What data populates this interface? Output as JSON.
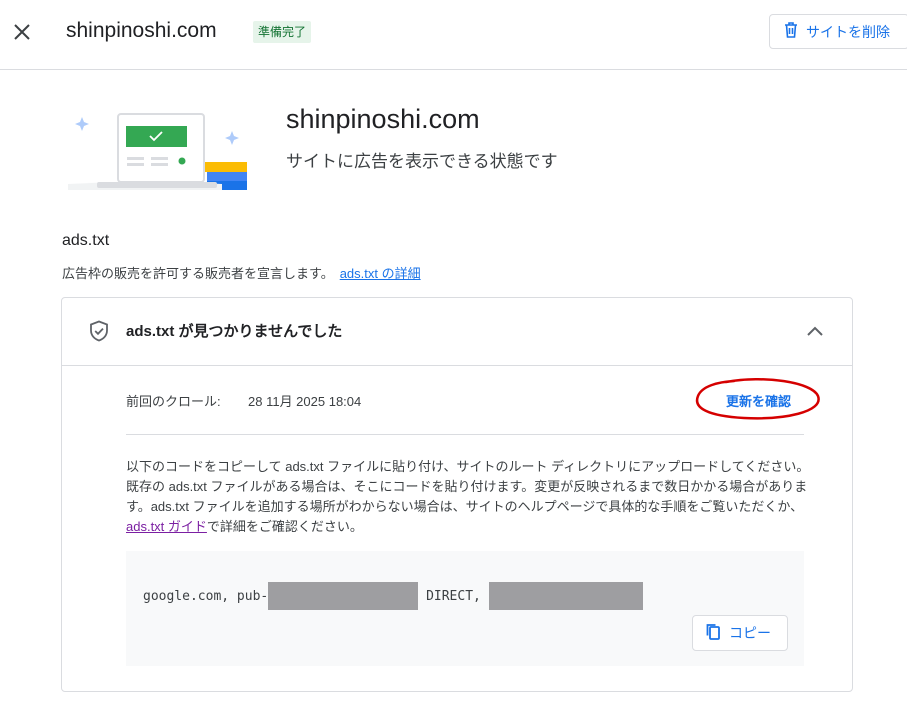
{
  "header": {
    "title": "shinpinoshi.com",
    "status_badge": "準備完了",
    "delete_button": "サイトを削除"
  },
  "hero": {
    "domain": "shinpinoshi.com",
    "status": "サイトに広告を表示できる状態です"
  },
  "ads_txt": {
    "title": "ads.txt",
    "description": "広告枠の販売を許可する販売者を宣言します。",
    "details_link": "ads.txt の詳細",
    "panel": {
      "title": "ads.txt が見つかりませんでした",
      "last_crawl_label": "前回のクロール:",
      "last_crawl_value": "28 11月 2025 18:04",
      "check_update": "更新を確認",
      "instructions_before": "以下のコードをコピーして ads.txt ファイルに貼り付け、サイトのルート ディレクトリにアップロードしてください。既存の ads.txt ファイルがある場合は、そこにコードを貼り付けます。変更が反映されるまで数日かかる場合があります。ads.txt ファイルを追加する場所がわからない場合は、サイトのヘルプページで具体的な手順をご覧いただくか、",
      "guide_link": "ads.txt ガイド",
      "instructions_after": "で詳細をご確認ください。",
      "code_prefix": "google.com, pub-",
      "code_middle": "DIRECT,",
      "copy_button": "コピー"
    }
  },
  "icons": {
    "close": "close-icon",
    "delete": "trash-icon",
    "shield": "shield-check-icon",
    "collapse": "chevron-up-icon",
    "copy": "copy-icon"
  },
  "colors": {
    "accent": "#1a73e8",
    "badge_bg": "#e6f4ea",
    "badge_text": "#137333",
    "annotation": "#d50000",
    "link_visited": "#7b1fa2"
  }
}
